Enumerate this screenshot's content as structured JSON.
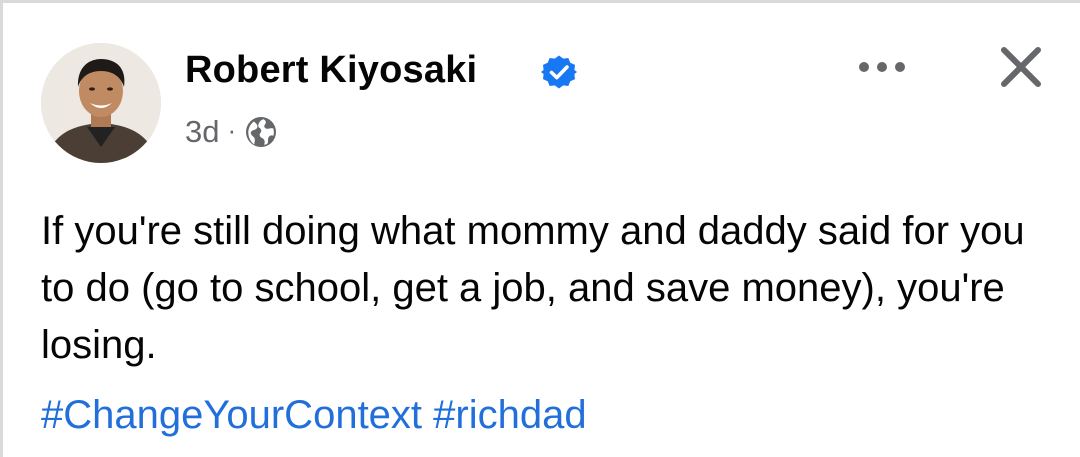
{
  "post": {
    "author_name": "Robert Kiyosaki",
    "verified_icon": "verified-badge-icon",
    "timestamp": "3d",
    "separator": "·",
    "audience_icon": "globe-icon",
    "more_icon": "more-options-icon",
    "close_icon": "close-icon",
    "text": "If you're still doing what mommy and daddy said for you to do (go to school, get a job, and save money), you're losing.",
    "hashtags": [
      {
        "label": "#ChangeYourContext"
      },
      {
        "label": "#richdad"
      }
    ]
  },
  "colors": {
    "text_primary": "#050505",
    "text_secondary": "#65676b",
    "link": "#216fdb",
    "verified": "#1877f2"
  }
}
